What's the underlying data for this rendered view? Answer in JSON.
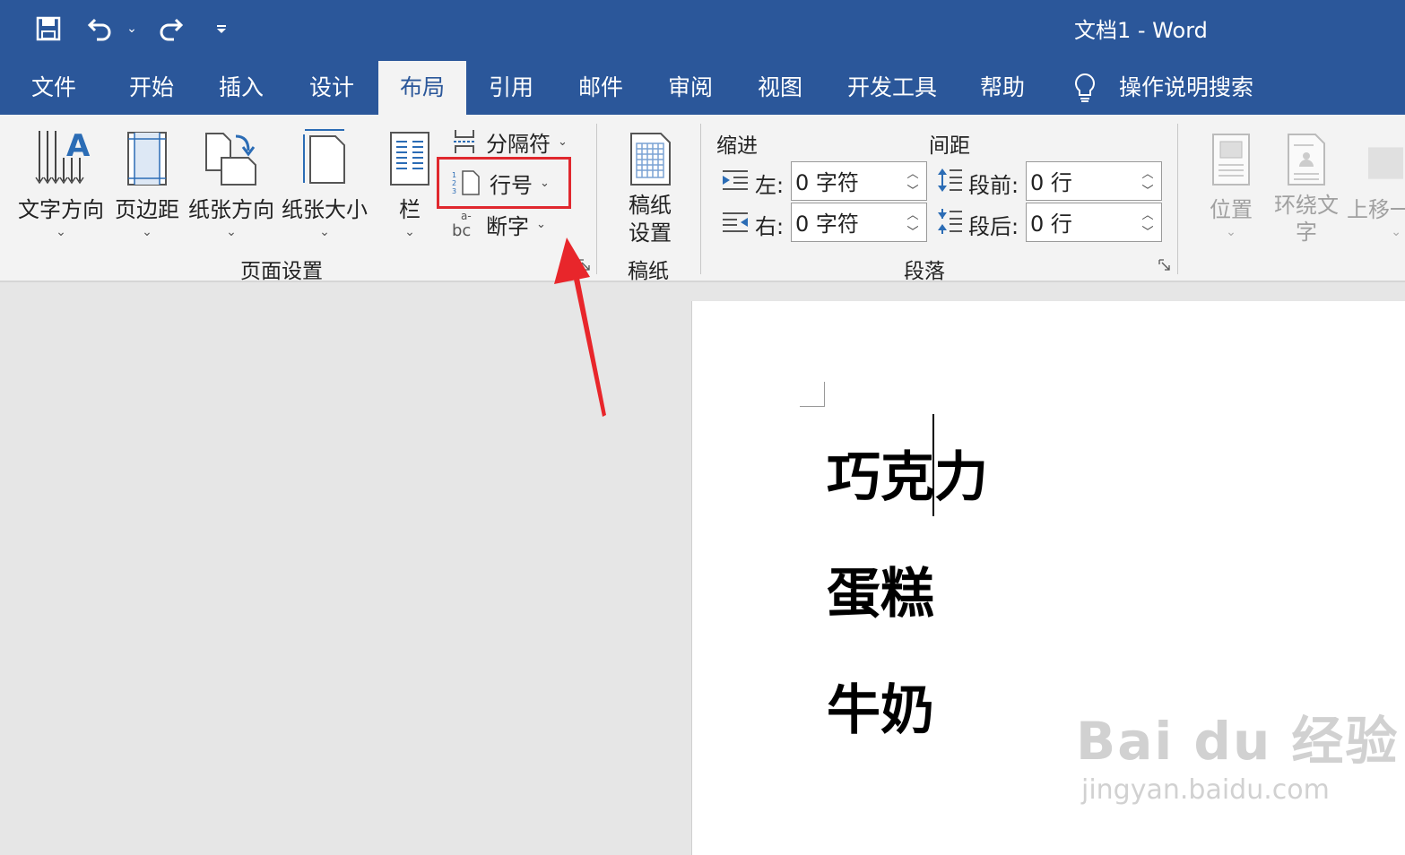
{
  "window": {
    "title": "文档1  -  Word"
  },
  "tabs": [
    {
      "label": "文件"
    },
    {
      "label": "开始"
    },
    {
      "label": "插入"
    },
    {
      "label": "设计"
    },
    {
      "label": "布局"
    },
    {
      "label": "引用"
    },
    {
      "label": "邮件"
    },
    {
      "label": "审阅"
    },
    {
      "label": "视图"
    },
    {
      "label": "开发工具"
    },
    {
      "label": "帮助"
    }
  ],
  "active_tab": "布局",
  "search": {
    "label": "操作说明搜索"
  },
  "page_setup": {
    "text_direction": "文字方向",
    "margins": "页边距",
    "orientation": "纸张方向",
    "size": "纸张大小",
    "columns": "栏",
    "breaks": "分隔符",
    "line_numbers": "行号",
    "hyphenation": "断字",
    "group_label": "页面设置"
  },
  "manuscript": {
    "button": "稿纸\n设置",
    "group_label": "稿纸"
  },
  "paragraph": {
    "indent_title": "缩进",
    "spacing_title": "间距",
    "left_label": "左:",
    "right_label": "右:",
    "left_value": "0 字符",
    "right_value": "0 字符",
    "before_label": "段前:",
    "after_label": "段后:",
    "before_value": "0 行",
    "after_value": "0 行",
    "group_label": "段落"
  },
  "arrange": {
    "position": "位置",
    "wrap_text": "环绕文\n字",
    "bring_forward": "上移一"
  },
  "document": {
    "lines": [
      "巧克力",
      "蛋糕",
      "牛奶"
    ]
  },
  "watermark": {
    "main": "Bai du 经验",
    "sub": "jingyan.baidu.com"
  },
  "colors": {
    "accent": "#2b579a",
    "highlight": "#e0282e",
    "arrow": "#e8262b"
  }
}
